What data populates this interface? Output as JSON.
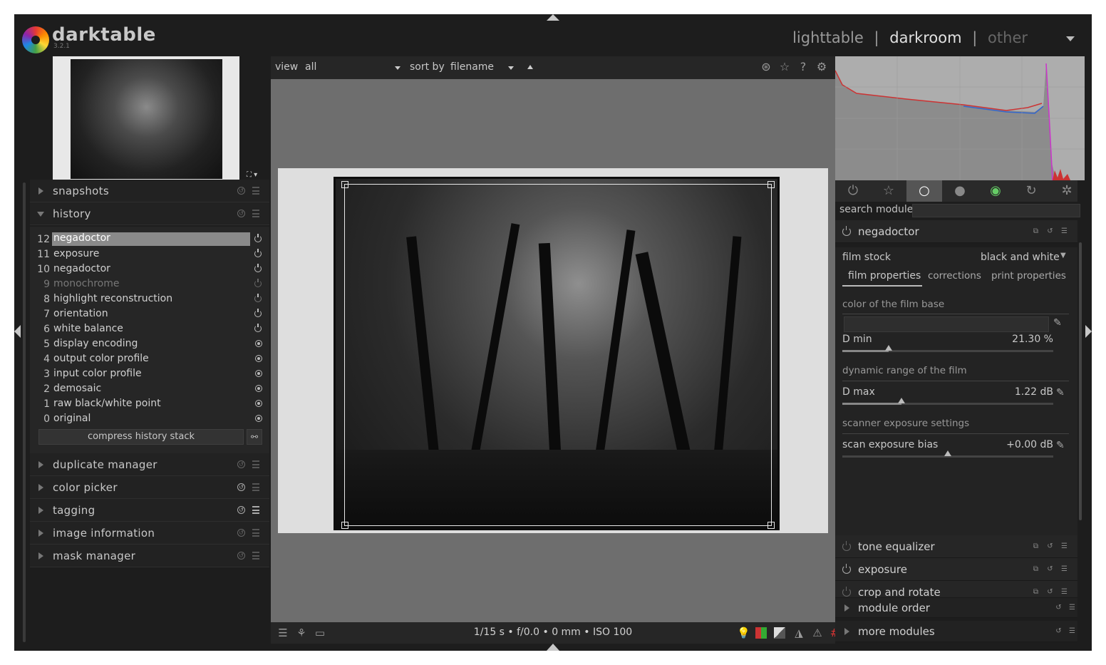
{
  "app": {
    "name": "darktable",
    "version": "3.2.1"
  },
  "views": {
    "lighttable": "lighttable",
    "sep1": "|",
    "darkroom": "darkroom",
    "sep2": "|",
    "other": "other"
  },
  "left": {
    "snapshots": "snapshots",
    "history": "history",
    "history_items": [
      {
        "n": "12",
        "label": "negadoctor"
      },
      {
        "n": "11",
        "label": "exposure"
      },
      {
        "n": "10",
        "label": "negadoctor"
      },
      {
        "n": "9",
        "label": "monochrome"
      },
      {
        "n": "8",
        "label": "highlight reconstruction"
      },
      {
        "n": "7",
        "label": "orientation"
      },
      {
        "n": "6",
        "label": "white balance"
      },
      {
        "n": "5",
        "label": "display encoding"
      },
      {
        "n": "4",
        "label": "output color profile"
      },
      {
        "n": "3",
        "label": "input color profile"
      },
      {
        "n": "2",
        "label": "demosaic"
      },
      {
        "n": "1",
        "label": "raw black/white point"
      },
      {
        "n": "0",
        "label": "original"
      }
    ],
    "compress": "compress history stack",
    "duplicate": "duplicate manager",
    "color_picker": "color picker",
    "tagging": "tagging",
    "image_info": "image information",
    "mask_manager": "mask manager"
  },
  "topbar": {
    "view_label": "view",
    "view_value": "all",
    "sort_label": "sort by",
    "sort_value": "filename"
  },
  "bottombar": {
    "exif": "1/15 s • f/0.0 • 0 mm • ISO 100"
  },
  "right": {
    "search_label": "search module",
    "search_value": "",
    "negadoctor": "negadoctor",
    "film_stock_label": "film stock",
    "film_stock_value": "black and white",
    "tabs": [
      "film properties",
      "corrections",
      "print properties"
    ],
    "film_base": "color of the film base",
    "dmin_label": "D min",
    "dmin_value": "21.30 %",
    "dmin_level": 0.22,
    "dynamic_range": "dynamic range of the film",
    "dmax_label": "D max",
    "dmax_value": "1.22 dB",
    "dmax_level": 0.28,
    "scanner": "scanner exposure settings",
    "bias_label": "scan exposure bias",
    "bias_value": "+0.00 dB",
    "bias_level": 0.5,
    "tone_equalizer": "tone equalizer",
    "exposure": "exposure",
    "crop_rotate": "crop and rotate",
    "module_order": "module order",
    "more_modules": "more modules"
  },
  "colors": {
    "accent_selected": "#8a8a8a",
    "background": "#1d1d1d"
  }
}
